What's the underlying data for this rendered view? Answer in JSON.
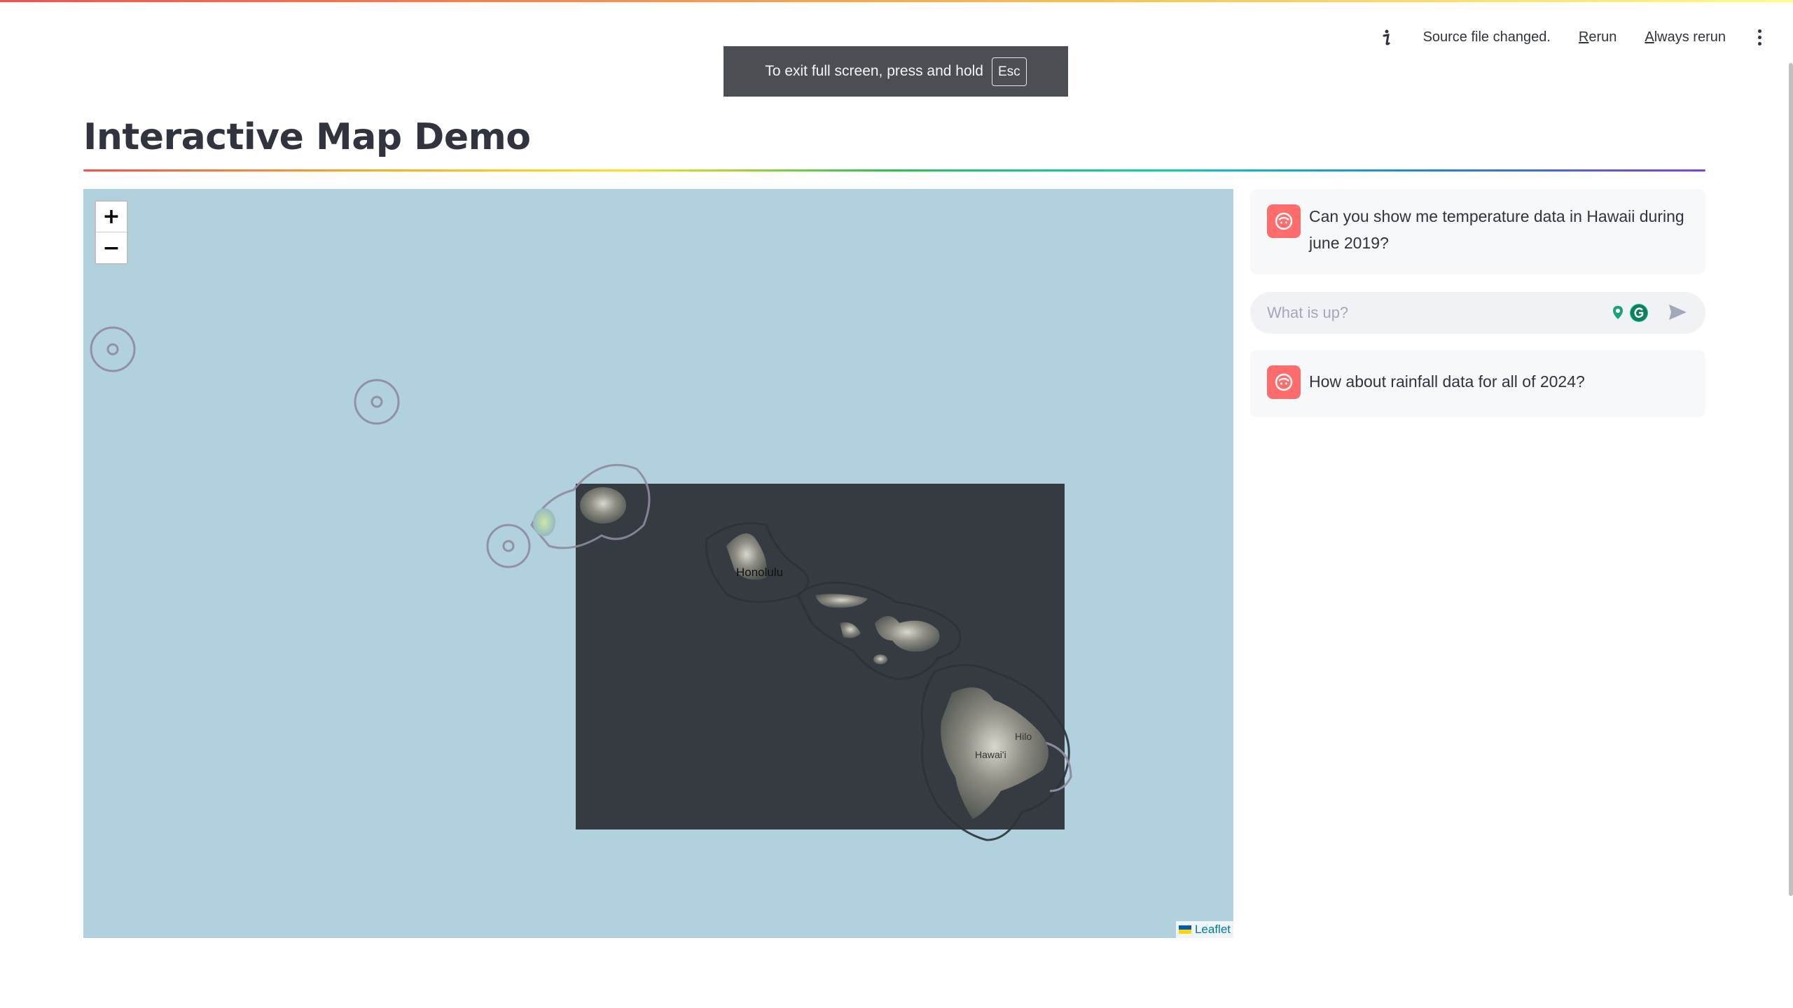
{
  "toolbar": {
    "status": "Source file changed.",
    "rerun_prefix": "R",
    "rerun_rest": "erun",
    "always_prefix": "A",
    "always_rest": "lways rerun"
  },
  "fullscreen_notice": {
    "text": "To exit full screen, press and hold",
    "key": "Esc"
  },
  "page": {
    "title": "Interactive Map Demo"
  },
  "map": {
    "zoom_in": "+",
    "zoom_out": "−",
    "attribution": "Leaflet",
    "labels": {
      "honolulu": "Honolulu",
      "hawaii": "Hawai'i",
      "hilo": "Hilo"
    }
  },
  "chat": {
    "messages": [
      {
        "text": "Can you show me temperature data in Hawaii during june 2019?"
      },
      {
        "text": "How about rainfall data for all of 2024?"
      }
    ],
    "input_placeholder": "What is up?"
  },
  "colors": {
    "ocean": "#b1d1de",
    "raster": "#353b40",
    "avatar": "#ff6c6c"
  }
}
